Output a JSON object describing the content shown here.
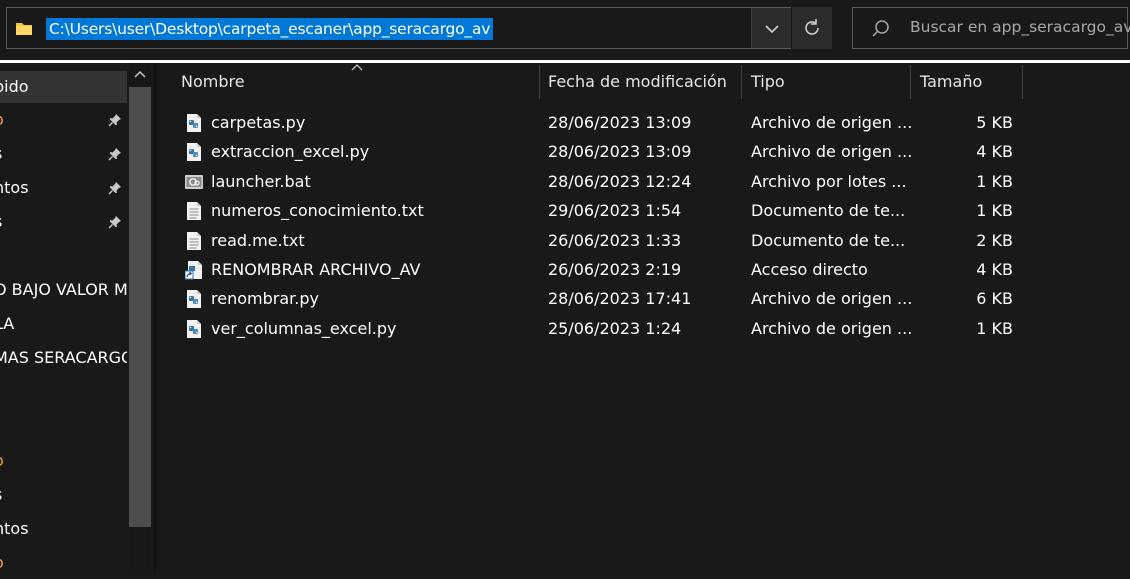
{
  "address_bar": {
    "path": "C:\\Users\\user\\Desktop\\carpeta_escaner\\app_seracargo_av"
  },
  "search": {
    "placeholder": "Buscar en app_seracargo_av"
  },
  "sidebar": {
    "items": [
      {
        "label": "pido",
        "pinned": false,
        "selected": true
      },
      {
        "label": "o",
        "pinned": true,
        "selected": false,
        "accent": true
      },
      {
        "label": "s",
        "pinned": true,
        "selected": false
      },
      {
        "label": "ntos",
        "pinned": true,
        "selected": false
      },
      {
        "label": "s",
        "pinned": true,
        "selected": false
      },
      {
        "label": "",
        "pinned": false,
        "selected": false
      },
      {
        "label": "O BAJO VALOR MF",
        "pinned": false,
        "selected": false
      },
      {
        "label": "LA",
        "pinned": false,
        "selected": false
      },
      {
        "label": "MAS SERACARGO",
        "pinned": false,
        "selected": false
      },
      {
        "label": "",
        "pinned": false,
        "selected": false
      },
      {
        "label": "",
        "pinned": false,
        "selected": false
      },
      {
        "label": "o",
        "pinned": false,
        "selected": false,
        "accent": true
      },
      {
        "label": "s",
        "pinned": false,
        "selected": false
      },
      {
        "label": "ntos",
        "pinned": false,
        "selected": false
      },
      {
        "label": "o",
        "pinned": false,
        "selected": false,
        "accent": true
      }
    ]
  },
  "columns": {
    "name": "Nombre",
    "date": "Fecha de modificación",
    "type": "Tipo",
    "size": "Tamaño"
  },
  "files": [
    {
      "name": "carpetas.py",
      "date": "28/06/2023 13:09",
      "type": "Archivo de origen ...",
      "size": "5 KB",
      "icon": "python-file-icon"
    },
    {
      "name": "extraccion_excel.py",
      "date": "28/06/2023 13:09",
      "type": "Archivo de origen ...",
      "size": "4 KB",
      "icon": "python-file-icon"
    },
    {
      "name": "launcher.bat",
      "date": "28/06/2023 12:24",
      "type": "Archivo por lotes ...",
      "size": "1 KB",
      "icon": "batch-file-icon"
    },
    {
      "name": "numeros_conocimiento.txt",
      "date": "29/06/2023 1:54",
      "type": "Documento de te...",
      "size": "1 KB",
      "icon": "text-file-icon"
    },
    {
      "name": "read.me.txt",
      "date": "26/06/2023 1:33",
      "type": "Documento de te...",
      "size": "2 KB",
      "icon": "text-file-icon"
    },
    {
      "name": "RENOMBRAR ARCHIVO_AV",
      "date": "26/06/2023 2:19",
      "type": "Acceso directo",
      "size": "4 KB",
      "icon": "shortcut-icon"
    },
    {
      "name": "renombrar.py",
      "date": "28/06/2023 17:41",
      "type": "Archivo de origen ...",
      "size": "6 KB",
      "icon": "python-file-icon"
    },
    {
      "name": "ver_columnas_excel.py",
      "date": "25/06/2023 1:24",
      "type": "Archivo de origen ...",
      "size": "1 KB",
      "icon": "python-file-icon"
    }
  ],
  "colors": {
    "background": "#191919",
    "selection": "#0078d7",
    "folder": "#f4c542",
    "accent_sidebar": "#f0a030",
    "python_blue": "#3776ab"
  }
}
